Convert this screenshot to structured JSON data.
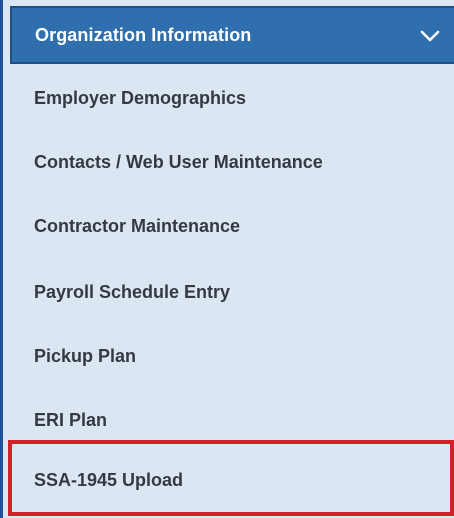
{
  "menu": {
    "header": {
      "title": "Organization Information",
      "icon": "chevron-down-icon"
    },
    "items": [
      {
        "label": "Employer Demographics"
      },
      {
        "label": "Contacts / Web User Maintenance"
      },
      {
        "label": "Contractor Maintenance"
      },
      {
        "label": "Payroll Schedule Entry"
      },
      {
        "label": "Pickup Plan"
      },
      {
        "label": "ERI Plan"
      },
      {
        "label": "SSA-1945 Upload"
      }
    ]
  },
  "colors": {
    "header_bg": "#2f6fad",
    "panel_bg": "#dce6f2",
    "highlight_border": "#d42026",
    "text": "#333a44"
  }
}
